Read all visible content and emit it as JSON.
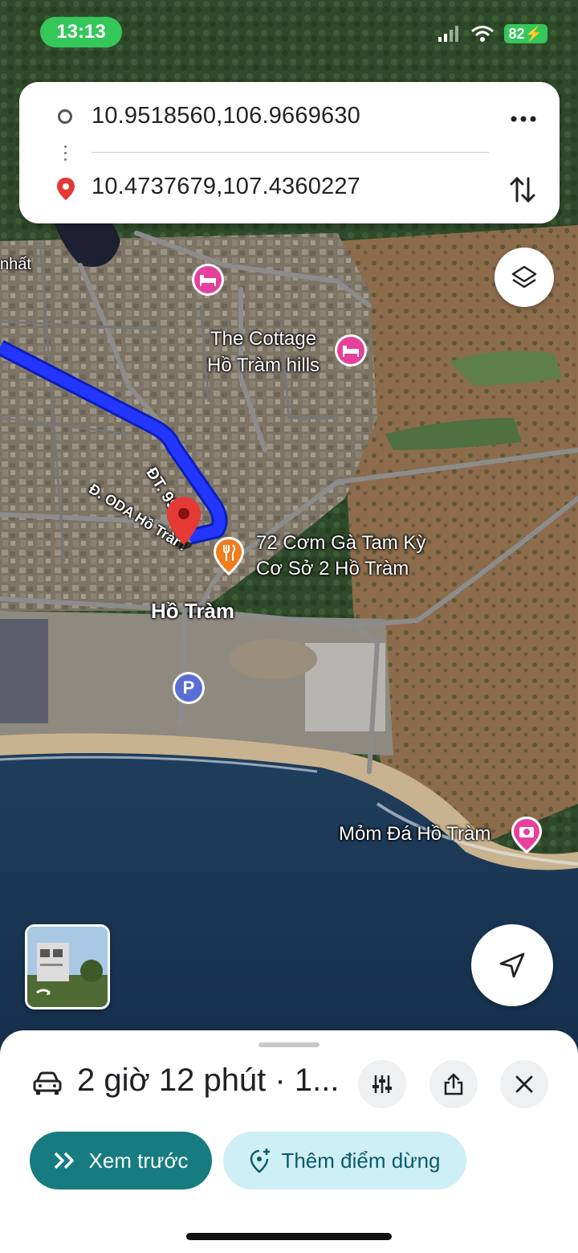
{
  "status_bar": {
    "time": "13:13",
    "battery": "82"
  },
  "route_card": {
    "origin": "10.9518560,106.9669630",
    "destination": "10.4737679,107.4360227"
  },
  "map": {
    "labels": {
      "nhat": "nhất",
      "cottage_line1": "The Cottage",
      "cottage_line2": "Hồ Tràm hills",
      "road_dt998": "ĐT. 998",
      "road_oda": "Đ. ODA Hồ Tràm",
      "restaurant_line1": "72 Cơm Gà Tam Kỳ",
      "restaurant_line2": "Cơ Sở 2 Hồ Tràm",
      "area": "Hồ Tràm",
      "parking": "P",
      "mom_da": "Mỏm Đá Hồ Tràm"
    },
    "route_color": "#1a3cff",
    "hotel_pin_color": "#e6409a",
    "restaurant_pin_color": "#f07c1e",
    "destination_pin_color": "#e53935"
  },
  "bottom_sheet": {
    "summary": "2 giờ 12 phút · 1...",
    "preview_label": "Xem trước",
    "add_stop_label": "Thêm điểm dừng"
  },
  "icons": {
    "car": "car-icon",
    "tune": "tune-icon",
    "share": "share-icon",
    "close": "close-icon",
    "layers": "layers-icon",
    "navigate": "navigate-arrow-icon",
    "more": "more-horizontal-icon",
    "swap": "swap-vertical-icon"
  }
}
